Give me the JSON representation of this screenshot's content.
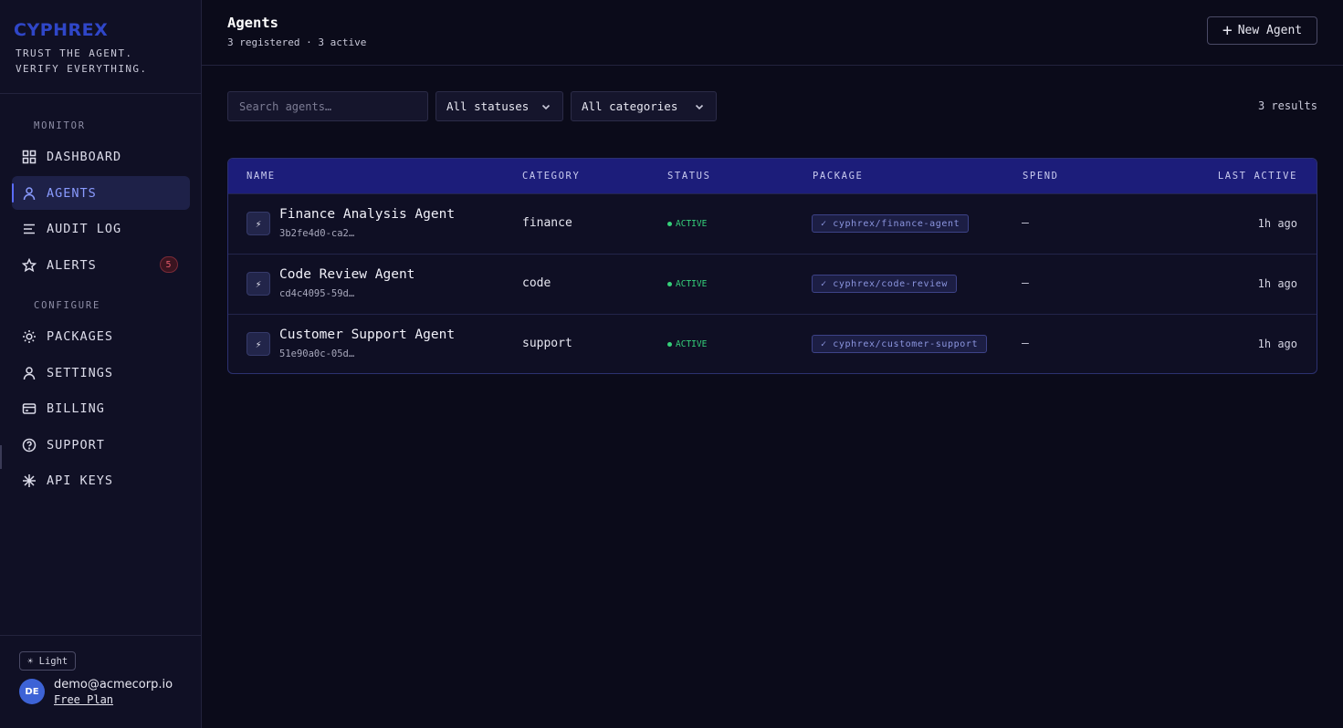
{
  "brand": {
    "logo": "CYPHREX",
    "tagline_line1": "TRUST THE AGENT.",
    "tagline_line2": "VERIFY EVERYTHING."
  },
  "sidebar": {
    "monitor_label": "MONITOR",
    "configure_label": "CONFIGURE",
    "items": [
      {
        "label": "DASHBOARD",
        "icon": "grid-icon"
      },
      {
        "label": "AGENTS",
        "icon": "agent-icon",
        "active": true
      },
      {
        "label": "AUDIT LOG",
        "icon": "lines-icon"
      },
      {
        "label": "ALERTS",
        "icon": "star-icon",
        "badge": "5"
      },
      {
        "label": "PACKAGES",
        "icon": "sun-icon"
      },
      {
        "label": "SETTINGS",
        "icon": "user-icon"
      },
      {
        "label": "BILLING",
        "icon": "card-icon"
      },
      {
        "label": "SUPPORT",
        "icon": "help-icon"
      },
      {
        "label": "API KEYS",
        "icon": "asterisk-icon"
      }
    ]
  },
  "footer": {
    "theme_label": "☀ Light",
    "avatar_initials": "DE",
    "email": "demo@acmecorp.io",
    "plan": "Free Plan"
  },
  "header": {
    "title": "Agents",
    "subtitle": "3 registered · 3 active",
    "new_button": "New Agent"
  },
  "filters": {
    "search_placeholder": "Search agents…",
    "status_select": "All statuses",
    "category_select": "All categories",
    "results": "3 results"
  },
  "table": {
    "columns": [
      "NAME",
      "CATEGORY",
      "STATUS",
      "PACKAGE",
      "SPEND",
      "LAST ACTIVE"
    ],
    "rows": [
      {
        "icon": "⚡",
        "name": "Finance Analysis Agent",
        "id": "3b2fe4d0-ca2…",
        "category": "finance",
        "status": "ACTIVE",
        "package": "✓ cyphrex/finance-agent",
        "spend": "—",
        "last_active": "1h ago"
      },
      {
        "icon": "⚡",
        "name": "Code Review Agent",
        "id": "cd4c4095-59d…",
        "category": "code",
        "status": "ACTIVE",
        "package": "✓ cyphrex/code-review",
        "spend": "—",
        "last_active": "1h ago"
      },
      {
        "icon": "⚡",
        "name": "Customer Support Agent",
        "id": "51e90a0c-05d…",
        "category": "support",
        "status": "ACTIVE",
        "package": "✓ cyphrex/customer-support",
        "spend": "—",
        "last_active": "1h ago"
      }
    ]
  },
  "colors": {
    "accent": "#5a6cff",
    "table_header": "#1c1d7a",
    "status_active": "#35d07a",
    "badge": "#e05a6a"
  }
}
